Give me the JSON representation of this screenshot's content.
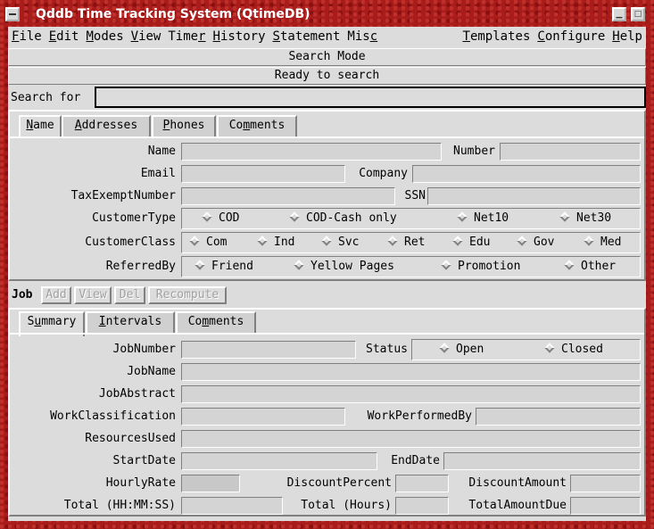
{
  "window": {
    "title": "Qddb Time Tracking System (QtimeDB)"
  },
  "menubar": [
    {
      "label": "File"
    },
    {
      "label": "Edit"
    },
    {
      "label": "Modes"
    },
    {
      "label": "View"
    },
    {
      "label": "Timer"
    },
    {
      "label": "History"
    },
    {
      "label": "Statement"
    },
    {
      "label": "Misc"
    },
    {
      "label": "Templates"
    },
    {
      "label": "Configure"
    },
    {
      "label": "Help"
    }
  ],
  "status": {
    "mode": "Search Mode",
    "message": "Ready to search"
  },
  "search": {
    "label": "Search for",
    "value": ""
  },
  "customer": {
    "tabs": [
      "Name",
      "Addresses",
      "Phones",
      "Comments"
    ],
    "labels": {
      "name": "Name",
      "number": "Number",
      "email": "Email",
      "company": "Company",
      "tax": "TaxExemptNumber",
      "ssn": "SSN",
      "type": "CustomerType",
      "class": "CustomerClass",
      "referred": "ReferredBy"
    },
    "customer_type_options": [
      "COD",
      "COD-Cash only",
      "Net10",
      "Net30"
    ],
    "customer_class_options": [
      "Com",
      "Ind",
      "Svc",
      "Ret",
      "Edu",
      "Gov",
      "Med"
    ],
    "referred_by_options": [
      "Friend",
      "Yellow Pages",
      "Promotion",
      "Other"
    ]
  },
  "job": {
    "label": "Job",
    "buttons": [
      "Add",
      "View",
      "Del",
      "Recompute"
    ],
    "tabs": [
      "Summary",
      "Intervals",
      "Comments"
    ],
    "labels": {
      "number": "JobNumber",
      "status": "Status",
      "name": "JobName",
      "abstract": "JobAbstract",
      "classification": "WorkClassification",
      "performed": "WorkPerformedBy",
      "resources": "ResourcesUsed",
      "start": "StartDate",
      "end": "EndDate",
      "rate": "HourlyRate",
      "discount_pct": "DiscountPercent",
      "discount_amt": "DiscountAmount",
      "total_hms": "Total (HH:MM:SS)",
      "total_hours": "Total (Hours)",
      "total_due": "TotalAmountDue"
    },
    "status_options": [
      "Open",
      "Closed"
    ]
  }
}
